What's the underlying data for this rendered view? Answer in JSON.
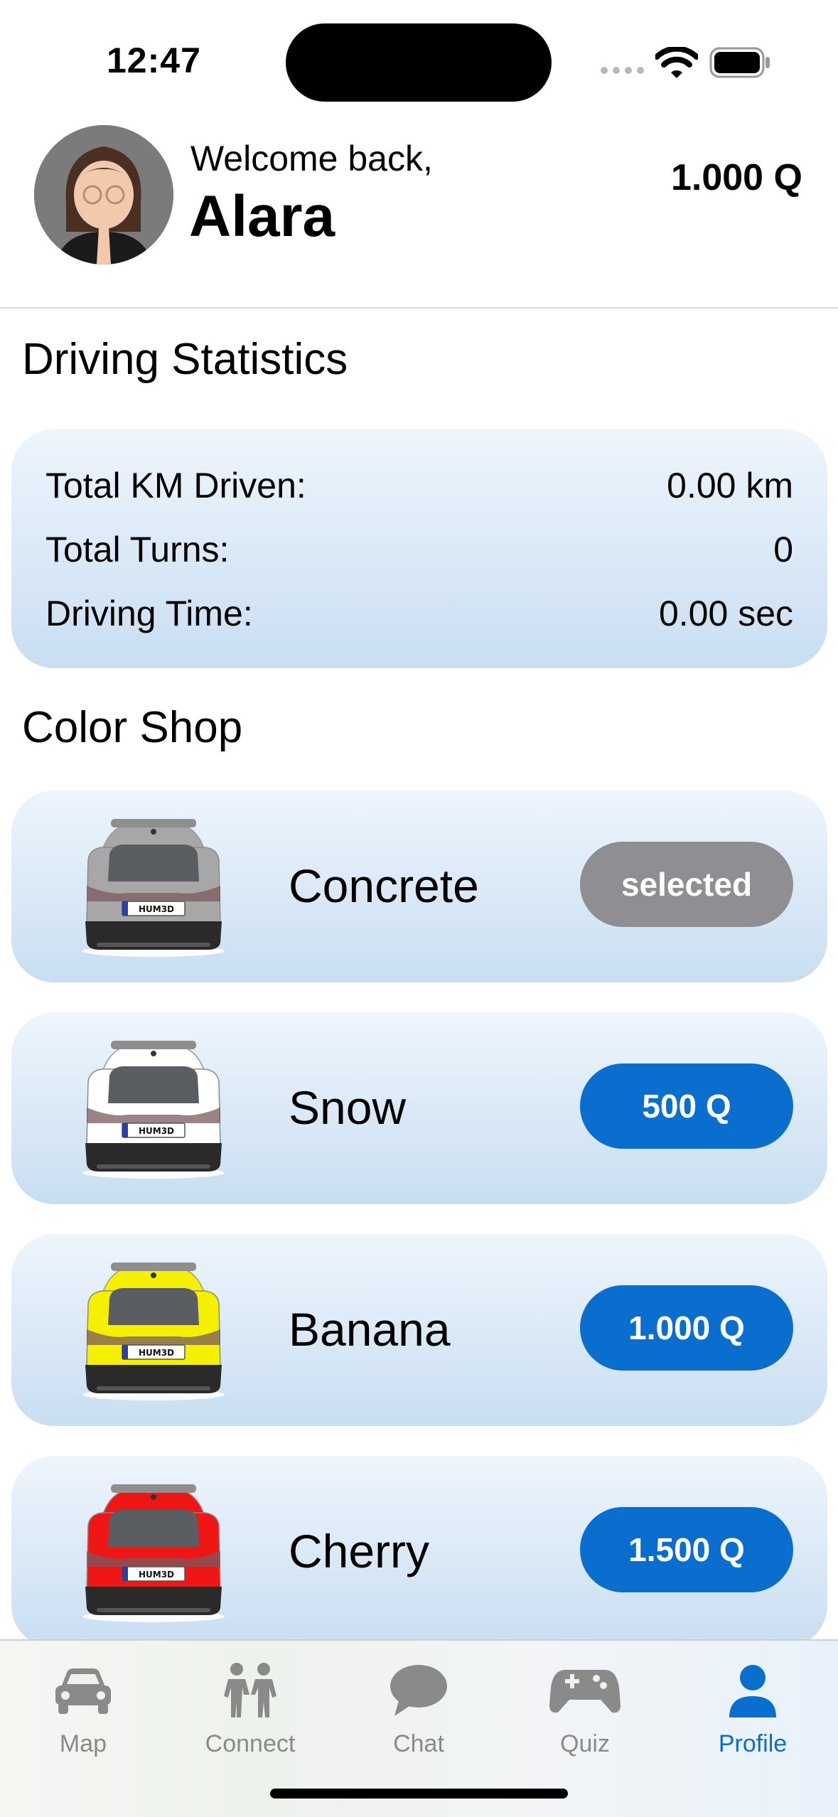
{
  "status_bar": {
    "time": "12:47"
  },
  "header": {
    "welcome": "Welcome back,",
    "username": "Alara",
    "balance": "1.000 Q"
  },
  "stats": {
    "title": "Driving Statistics",
    "rows": [
      {
        "label": "Total KM Driven:",
        "value": "0.00 km"
      },
      {
        "label": "Total Turns:",
        "value": "0"
      },
      {
        "label": "Driving Time:",
        "value": "0.00 sec"
      }
    ]
  },
  "shop": {
    "title": "Color Shop",
    "items": [
      {
        "name": "Concrete",
        "button": "selected",
        "car_color": "#a7a7a7",
        "state": "selected"
      },
      {
        "name": "Snow",
        "button": "500 Q",
        "car_color": "#ffffff",
        "state": "buy"
      },
      {
        "name": "Banana",
        "button": "1.000 Q",
        "car_color": "#f5f000",
        "state": "buy"
      },
      {
        "name": "Cherry",
        "button": "1.500 Q",
        "car_color": "#f01616",
        "state": "buy"
      }
    ],
    "plate": "HUM3D"
  },
  "tabs": [
    {
      "label": "Map",
      "icon": "car-icon",
      "active": false
    },
    {
      "label": "Connect",
      "icon": "people-icon",
      "active": false
    },
    {
      "label": "Chat",
      "icon": "chat-bubble-icon",
      "active": false
    },
    {
      "label": "Quiz",
      "icon": "gamepad-icon",
      "active": false
    },
    {
      "label": "Profile",
      "icon": "person-icon",
      "active": true
    }
  ],
  "colors": {
    "accent": "#0a6ecf",
    "selected_button": "#8e8e93"
  }
}
